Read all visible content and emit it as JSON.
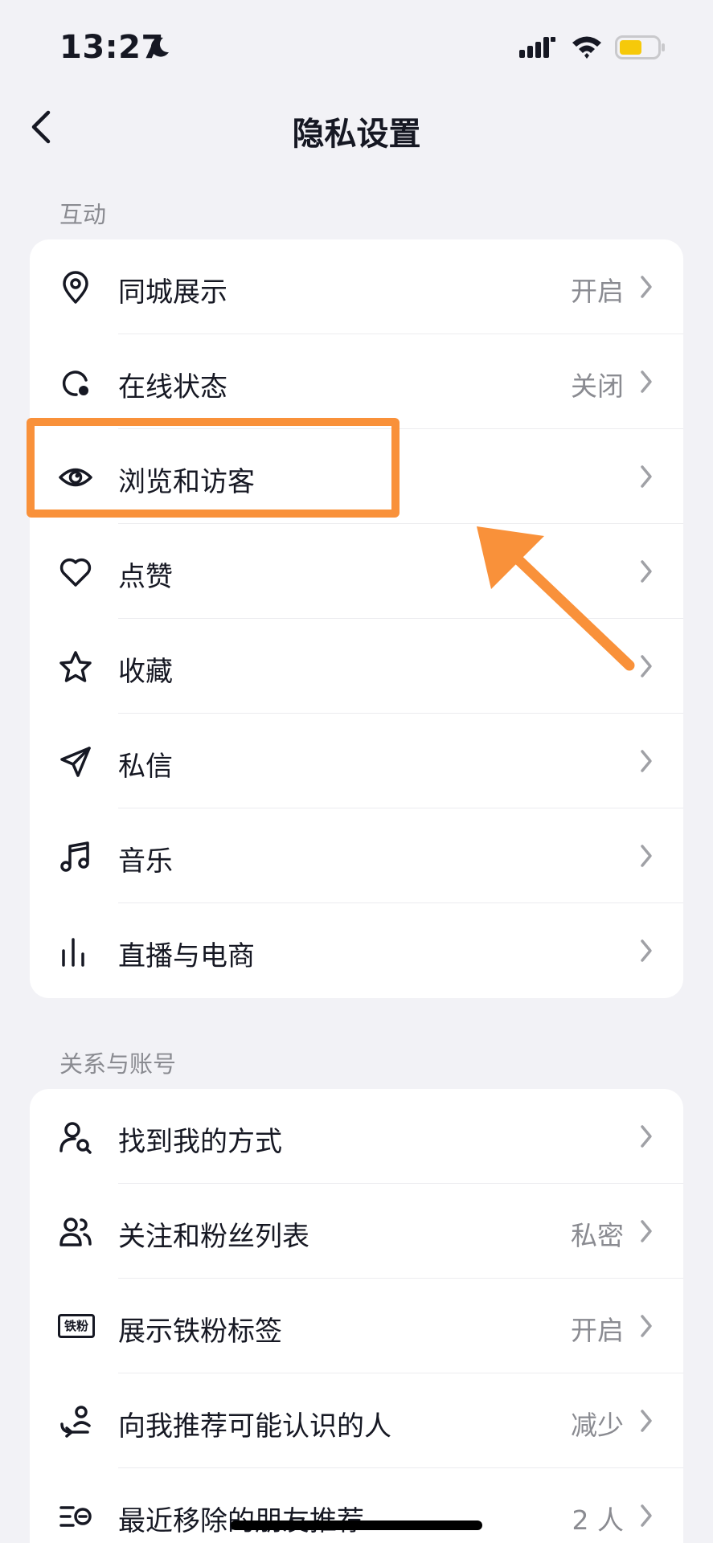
{
  "status_bar": {
    "time": "13:27"
  },
  "nav": {
    "title": "隐私设置"
  },
  "sections": [
    {
      "label": "互动",
      "items": [
        {
          "label": "同城展示",
          "value": "开启",
          "icon": "location-pin-icon"
        },
        {
          "label": "在线状态",
          "value": "关闭",
          "icon": "online-status-icon"
        },
        {
          "label": "浏览和访客",
          "value": "",
          "icon": "eye-icon"
        },
        {
          "label": "点赞",
          "value": "",
          "icon": "heart-icon"
        },
        {
          "label": "收藏",
          "value": "",
          "icon": "star-icon"
        },
        {
          "label": "私信",
          "value": "",
          "icon": "paper-plane-icon"
        },
        {
          "label": "音乐",
          "value": "",
          "icon": "music-note-icon"
        },
        {
          "label": "直播与电商",
          "value": "",
          "icon": "bar-chart-icon"
        }
      ]
    },
    {
      "label": "关系与账号",
      "items": [
        {
          "label": "找到我的方式",
          "value": "",
          "icon": "person-search-icon"
        },
        {
          "label": "关注和粉丝列表",
          "value": "私密",
          "icon": "people-icon"
        },
        {
          "label": "展示铁粉标签",
          "value": "开启",
          "icon": "fan-badge-icon",
          "badge_text": "铁粉"
        },
        {
          "label": "向我推荐可能认识的人",
          "value": "减少",
          "icon": "recommend-person-icon"
        },
        {
          "label": "最近移除的朋友推荐",
          "value": "2 人",
          "icon": "removed-list-icon"
        }
      ]
    }
  ],
  "annotation": {
    "color": "#f9913a"
  }
}
